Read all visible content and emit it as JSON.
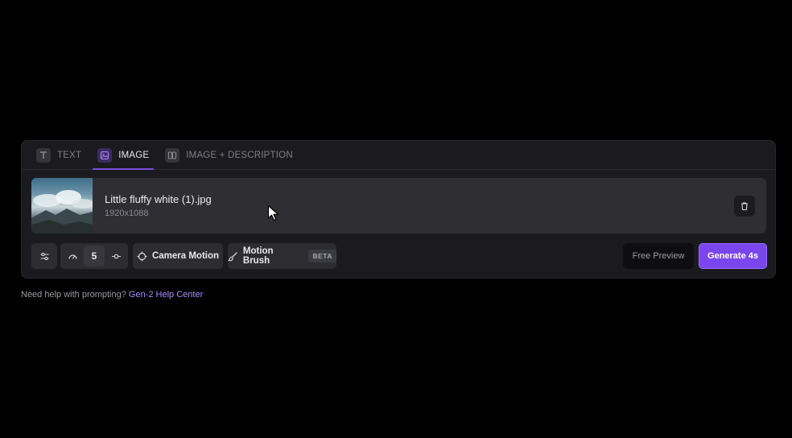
{
  "tabs": [
    {
      "label": "TEXT",
      "icon": "text-icon",
      "active": false
    },
    {
      "label": "IMAGE",
      "icon": "image-icon",
      "active": true
    },
    {
      "label": "IMAGE + DESCRIPTION",
      "icon": "image-description-icon",
      "active": false
    }
  ],
  "file": {
    "name": "Little fluffy white (1).jpg",
    "dimensions": "1920x1088",
    "thumbnail_icon": "sky-clouds-thumbnail",
    "delete_icon": "trash-icon"
  },
  "toolbar": {
    "settings_icon": "sliders-icon",
    "motion_icon": "gauge-icon",
    "motion_value": "5",
    "motion_adjust_icon": "slider-adjust-icon",
    "camera_motion_label": "Camera Motion",
    "camera_motion_icon": "crosshair-icon",
    "motion_brush_label": "Motion Brush",
    "motion_brush_icon": "brush-icon",
    "motion_brush_badge": "BETA",
    "free_preview_label": "Free Preview",
    "generate_label": "Generate 4s"
  },
  "help": {
    "text": "Need help with prompting?",
    "link": "Gen-2 Help Center"
  },
  "colors": {
    "accent": "#7b45ee",
    "panel": "#1b1b1f",
    "background": "#000000"
  }
}
